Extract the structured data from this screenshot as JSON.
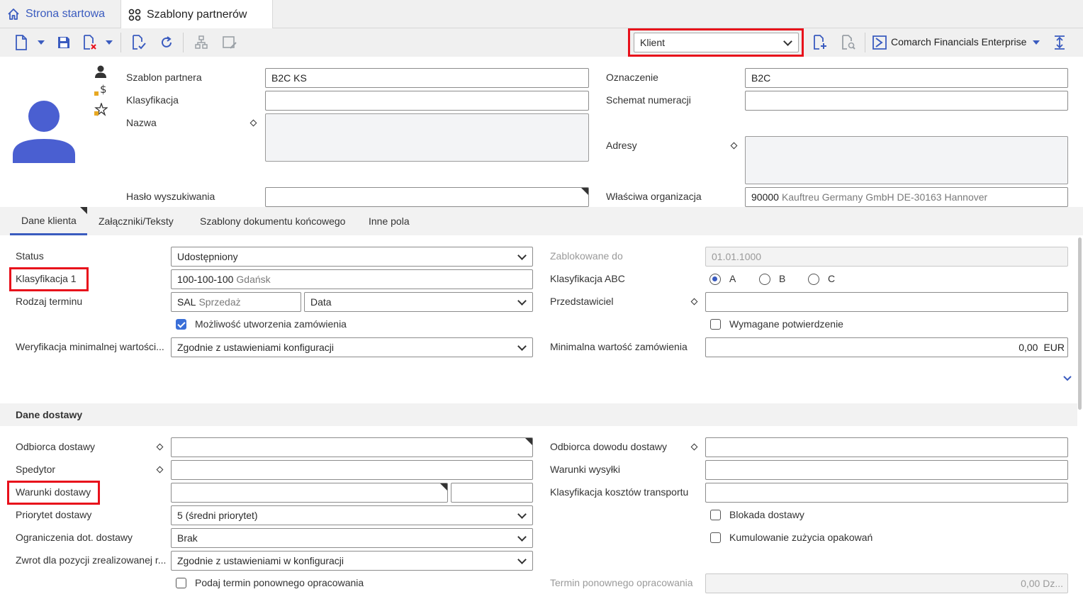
{
  "tabs": {
    "home": "Strona startowa",
    "active": "Szablony partnerów"
  },
  "toolbar": {
    "role_select": "Klient",
    "environment": "Comarch Financials Enterprise"
  },
  "header": {
    "partner_template_label": "Szablon partnera",
    "partner_template_value": "B2C KS",
    "classification_label": "Klasyfikacja",
    "classification_value": "",
    "name_label": "Nazwa",
    "name_value": "",
    "search_password_label": "Hasło wyszukiwania",
    "search_password_value": "",
    "designation_label": "Oznaczenie",
    "designation_value": "B2C",
    "numbering_scheme_label": "Schemat numeracji",
    "numbering_scheme_value": "",
    "addresses_label": "Adresy",
    "addresses_value": "",
    "org_label": "Właściwa organizacja",
    "org_code": "90000",
    "org_desc": "Kauftreu Germany GmbH DE-30163 Hannover"
  },
  "section_tabs": [
    "Dane klienta",
    "Załączniki/Teksty",
    "Szablony dokumentu końcowego",
    "Inne pola"
  ],
  "customer": {
    "status_label": "Status",
    "status_value": "Udostępniony",
    "class1_label": "Klasyfikacja 1",
    "class1_code": "100-100-100",
    "class1_desc": "Gdańsk",
    "date_type_label": "Rodzaj terminu",
    "date_type_code": "SAL",
    "date_type_desc": "Sprzedaż",
    "date_type_select": "Data",
    "order_possible_label": "Możliwość utworzenia zamówienia",
    "order_possible_checked": true,
    "min_value_check_label": "Weryfikacja minimalnej wartości...",
    "min_value_check_value": "Zgodnie z ustawieniami konfiguracji",
    "blocked_until_label": "Zablokowane do",
    "blocked_until_value": "01.01.1000",
    "abc_label": "Klasyfikacja ABC",
    "abc_options": [
      "A",
      "B",
      "C"
    ],
    "abc_selected": "A",
    "representative_label": "Przedstawiciel",
    "representative_value": "",
    "confirmation_required_label": "Wymagane potwierdzenie",
    "confirmation_required_checked": false,
    "min_order_value_label": "Minimalna wartość zamówienia",
    "min_order_value": "0,00",
    "min_order_currency": "EUR"
  },
  "delivery": {
    "section_title": "Dane dostawy",
    "recipient_label": "Odbiorca dostawy",
    "recipient_value": "",
    "forwarder_label": "Spedytor",
    "forwarder_value": "",
    "terms_label": "Warunki dostawy",
    "terms_value": "",
    "terms_extra": "",
    "priority_label": "Priorytet dostawy",
    "priority_value": "5 (średni priorytet)",
    "restrictions_label": "Ograniczenia dot. dostawy",
    "restrictions_value": "Brak",
    "return_label": "Zwrot dla pozycji zrealizowanej r...",
    "return_value": "Zgodnie z ustawieniami w konfiguracji",
    "reprocess_label": "Podaj termin ponownego opracowania",
    "reprocess_checked": false,
    "proof_recipient_label": "Odbiorca dowodu dostawy",
    "proof_recipient_value": "",
    "shipping_terms_label": "Warunki wysyłki",
    "shipping_terms_value": "",
    "transport_cost_label": "Klasyfikacja kosztów transportu",
    "transport_cost_value": "",
    "delivery_block_label": "Blokada dostawy",
    "delivery_block_checked": false,
    "packaging_label": "Kumulowanie zużycia opakowań",
    "packaging_checked": false,
    "reprocess_date_label": "Termin ponownego opracowania",
    "reprocess_date_value": "0,00 Dz..."
  },
  "colors": {
    "accent": "#3a5bbf",
    "highlight": "#e8101b",
    "avatar": "#4a5fd1"
  }
}
